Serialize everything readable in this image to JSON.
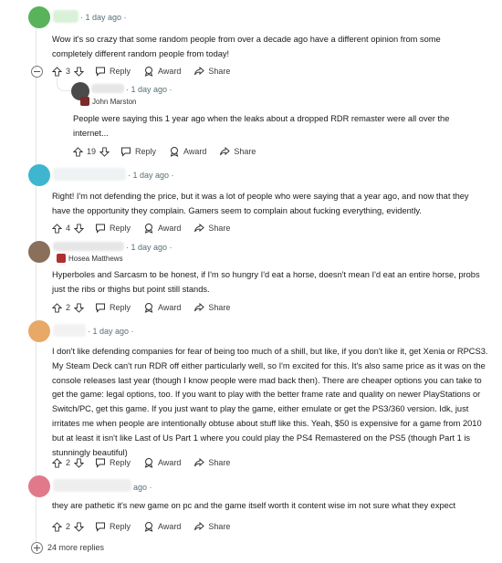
{
  "comments": [
    {
      "time": "1 day ago",
      "text": "Wow it's so crazy that some random people from over a decade ago have a different opinion from some completely different random people from today!",
      "score": "3",
      "avatar_color": "#58b35a"
    },
    {
      "time": "1 day ago",
      "flair": "John Marston",
      "text": "People were saying this 1 year ago when the leaks about a dropped RDR remaster were all over the internet...",
      "score": "19",
      "avatar_color": "#4a4a4a"
    },
    {
      "time": "1 day ago",
      "text": "Right! I'm not defending the price, but it was a lot of people who were saying that a year ago, and now that they have the opportunity they complain. Gamers seem to complain about fucking everything, evidently.",
      "score": "4",
      "avatar_color": "#3fb6cf"
    },
    {
      "time": "1 day ago",
      "flair": "Hosea Matthews",
      "text": "Hyperboles and Sarcasm to be honest, if I'm so hungry I'd eat a horse, doesn't mean I'd eat an entire horse, probs just the ribs or thighs but point still stands.",
      "score": "2",
      "avatar_color": "#8a6f5a"
    },
    {
      "time": "1 day ago",
      "text": "I don't like defending companies for fear of being too much of a shill, but like, if you don't like it, get Xenia or RPCS3. My Steam Deck can't run RDR off either particularly well, so I'm excited for this. It's also same price as it was on the console releases last year (though I know people were mad back then). There are cheaper options you can take to get the game: legal options, too. If you want to play with the better frame rate and quality on newer PlayStations or Switch/PC, get this game. If you just want to play the game, either emulate or get the PS3/360 version. Idk, just irritates me when people are intentionally obtuse about stuff like this. Yeah, $50 is expensive for a game from 2010 but at least it isn't like Last of Us Part 1 where you could play the PS4 Remastered on the PS5 (though Part 1 is stunningly beautiful)",
      "score": "2",
      "avatar_color": "#e8a866"
    },
    {
      "time": "ago",
      "text": "they are pathetic it's new game on pc and the game itself worth it content wise im not sure what they expect",
      "score": "2",
      "avatar_color": "#e07a8a"
    }
  ],
  "actions": {
    "reply": "Reply",
    "award": "Award",
    "share": "Share"
  },
  "more_replies": "24 more replies"
}
